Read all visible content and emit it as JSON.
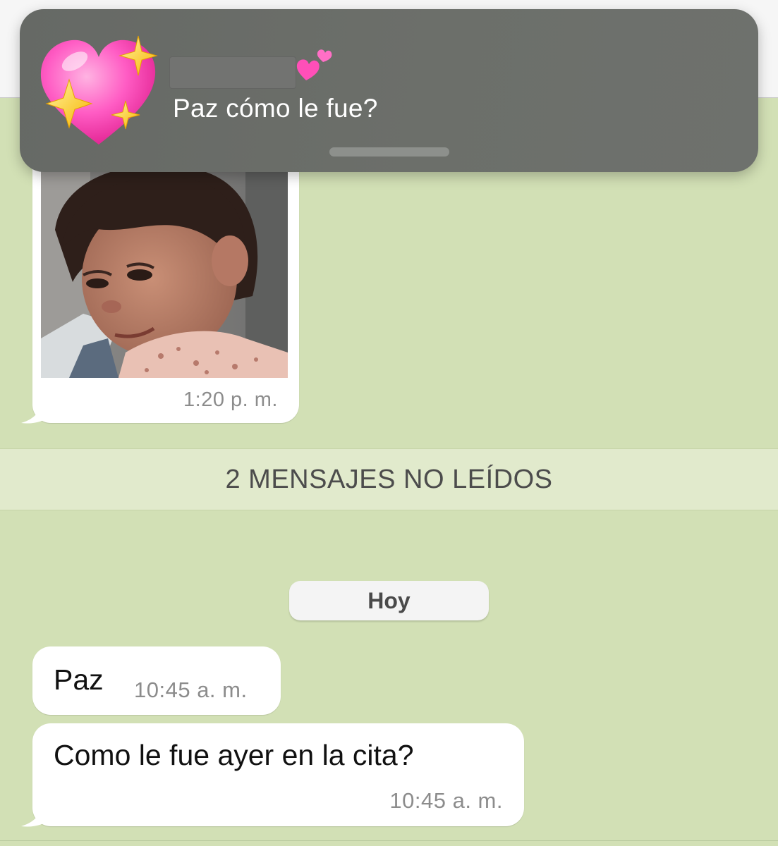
{
  "notification": {
    "icon": "sparkling-heart-emoji",
    "title_redacted": true,
    "title_suffix_icon": "two-hearts-emoji",
    "body": "Paz cómo le fue?"
  },
  "chat": {
    "photo_message": {
      "image": "toddler-smirk-photo",
      "time": "1:20 p. m."
    },
    "unread_banner": "2 MENSAJES NO LEÍDOS",
    "date_separator": "Hoy",
    "messages": [
      {
        "text": "Paz",
        "time": "10:45 a. m."
      },
      {
        "text": "Como le fue ayer en la cita?",
        "time": "10:45 a. m."
      }
    ]
  },
  "colors": {
    "chat_background": "#d2e0b5",
    "bubble": "#ffffff",
    "unread_banner": "#e1eacc",
    "notification": "#6b6e6a"
  }
}
